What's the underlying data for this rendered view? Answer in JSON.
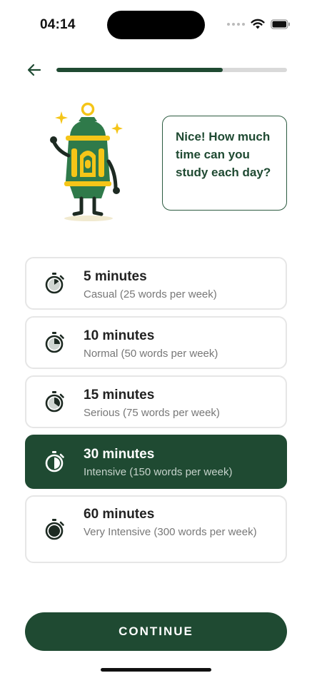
{
  "status_bar": {
    "time": "04:14"
  },
  "progress": {
    "value": 0.72
  },
  "mascot": {
    "icon": "lantern-mascot-icon"
  },
  "bubble": {
    "text": "Nice! How much time can you study each day?"
  },
  "options": [
    {
      "title": "5 minutes",
      "subtitle": "Casual (25 words per week)",
      "fill": 0.15,
      "selected": false
    },
    {
      "title": "10 minutes",
      "subtitle": "Normal (50 words per week)",
      "fill": 0.25,
      "selected": false
    },
    {
      "title": "15 minutes",
      "subtitle": "Serious (75 words per week)",
      "fill": 0.35,
      "selected": false
    },
    {
      "title": "30 minutes",
      "subtitle": "Intensive (150 words per week)",
      "fill": 0.5,
      "selected": true
    },
    {
      "title": "60 minutes",
      "subtitle": "Very Intensive (300 words per week)",
      "fill": 1.0,
      "selected": false
    }
  ],
  "continue_label": "CONTINUE",
  "colors": {
    "primary": "#1f4a32",
    "accent_gold": "#f5c518",
    "lantern_green": "#2f7a4a"
  }
}
